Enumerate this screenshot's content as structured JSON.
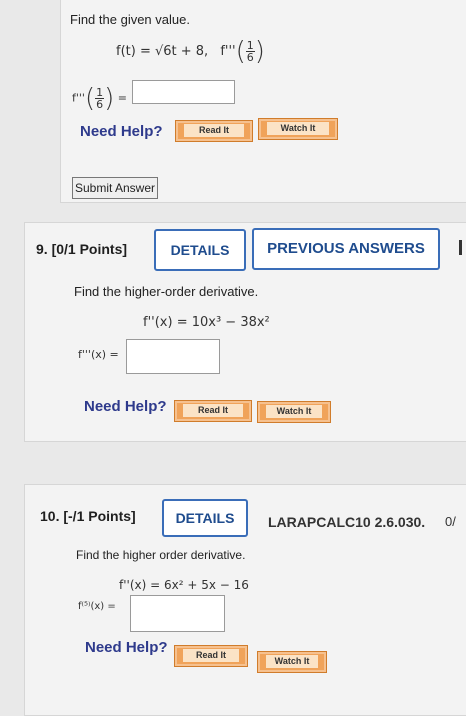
{
  "top": {
    "prompt": "Find the given value.",
    "function": "f(t) = √6t + 8,",
    "eval_fn": "f'''",
    "eval_num": "1",
    "eval_den": "6",
    "answer_label": "f'''",
    "answer_value": "",
    "need_help": "Need Help?",
    "read_it": "Read It",
    "watch_it": "Watch It",
    "submit": "Submit Answer"
  },
  "q9": {
    "number": "9.",
    "points": "[0/1 Points]",
    "details": "DETAILS",
    "previous": "PREVIOUS ANSWERS",
    "prompt": "Find the higher-order derivative.",
    "given": "f''(x) = 10x³ − 38x²",
    "answer_label": "f'''(x) =",
    "answer_value": "",
    "need_help": "Need Help?",
    "read_it": "Read It",
    "watch_it": "Watch It"
  },
  "q10": {
    "number": "10.",
    "points": "[-/1 Points]",
    "details": "DETAILS",
    "source": "LARAPCALC10 2.6.030.",
    "extra": "0/",
    "prompt": "Find the higher order derivative.",
    "given": "f''(x) = 6x² + 5x − 16",
    "answer_label": "f⁽⁵⁾(x) =",
    "answer_value": "",
    "need_help": "Need Help?",
    "read_it": "Read It",
    "watch_it": "Watch It"
  }
}
